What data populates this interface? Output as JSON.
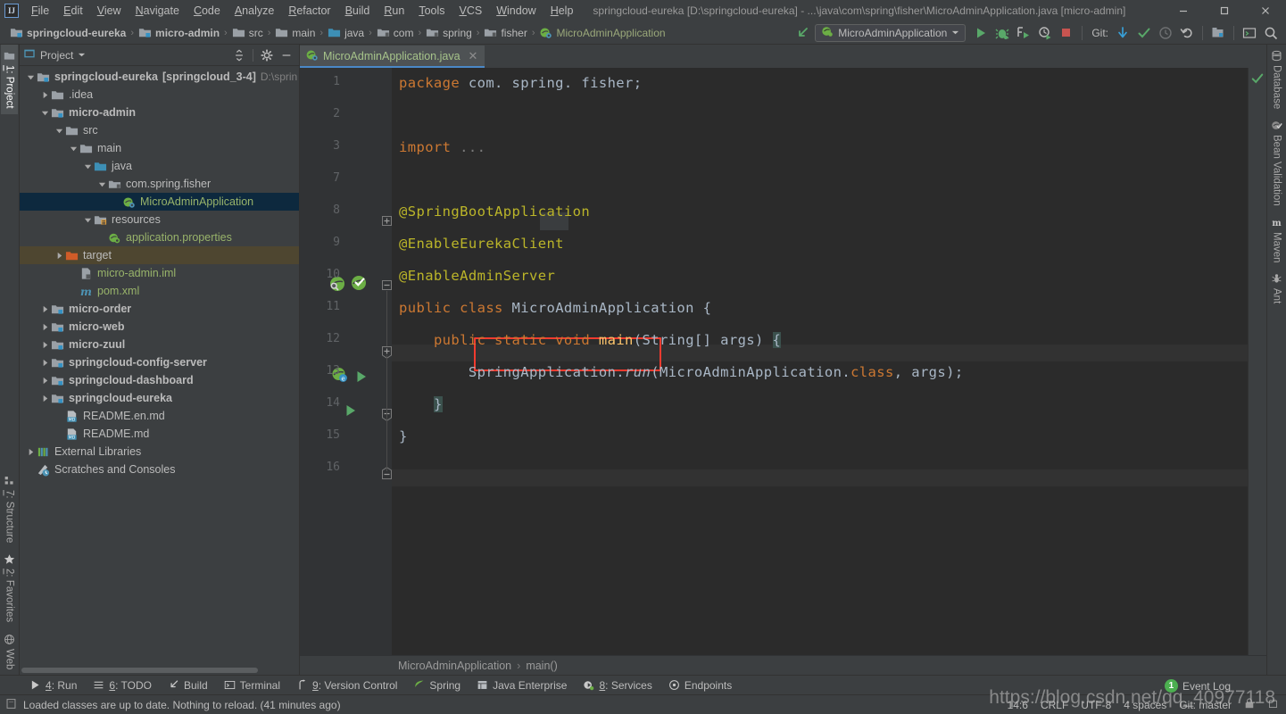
{
  "window": {
    "title": "springcloud-eureka [D:\\springcloud-eureka] - ...\\java\\com\\spring\\fisher\\MicroAdminApplication.java [micro-admin]",
    "logo": "IJ",
    "minimize": "minimize-icon",
    "maximize": "maximize-icon",
    "close": "close-icon"
  },
  "menu": [
    "File",
    "Edit",
    "View",
    "Navigate",
    "Code",
    "Analyze",
    "Refactor",
    "Build",
    "Run",
    "Tools",
    "VCS",
    "Window",
    "Help"
  ],
  "breadcrumbs": [
    {
      "label": "springcloud-eureka",
      "icon": "module-folder-icon",
      "bold": true
    },
    {
      "label": "micro-admin",
      "icon": "module-folder-icon",
      "bold": true
    },
    {
      "label": "src",
      "icon": "folder-icon",
      "bold": false
    },
    {
      "label": "main",
      "icon": "folder-icon",
      "bold": false
    },
    {
      "label": "java",
      "icon": "source-folder-icon",
      "bold": false
    },
    {
      "label": "com",
      "icon": "package-icon",
      "bold": false
    },
    {
      "label": "spring",
      "icon": "package-icon",
      "bold": false
    },
    {
      "label": "fisher",
      "icon": "package-icon",
      "bold": false
    },
    {
      "label": "MicroAdminApplication",
      "icon": "spring-class-icon",
      "bold": false,
      "green": true
    }
  ],
  "toolbar": {
    "back_arrow": "navigate-back-icon",
    "run_config": "MicroAdminApplication",
    "run_config_icon": "spring-boot-icon",
    "dropdown": "chevron-down-icon",
    "run": "run-icon",
    "debug": "debug-icon",
    "run_coverage": "run-with-coverage-icon",
    "profile": "profile-icon",
    "stop": "stop-icon",
    "git_label": "Git:",
    "git_update": "update-project-icon",
    "git_commit": "commit-icon",
    "git_history": "history-icon",
    "git_rollback": "rollback-icon",
    "project_structure": "project-structure-icon",
    "terminal": "terminal-icon",
    "search": "search-everywhere-icon"
  },
  "left_tabs": [
    {
      "label": "1: Project",
      "active": true,
      "icon": "project-icon"
    },
    {
      "label": "7: Structure",
      "active": false,
      "icon": "structure-icon"
    },
    {
      "label": "2: Favorites",
      "active": false,
      "icon": "star-icon"
    },
    {
      "label": "Web",
      "active": false,
      "icon": "web-icon"
    }
  ],
  "right_tabs": [
    {
      "label": "Database",
      "icon": "database-icon"
    },
    {
      "label": "Bean Validation",
      "icon": "bean-validation-icon"
    },
    {
      "label": "Maven",
      "icon": "maven-icon"
    },
    {
      "label": "Ant",
      "icon": "ant-icon"
    }
  ],
  "project_panel": {
    "title": "Project",
    "dropdown": "chevron-down-icon",
    "collapse_all": "collapse-all-icon",
    "settings": "gear-icon",
    "hide": "hide-icon",
    "tree": [
      {
        "label": "springcloud-eureka",
        "sub": "[springcloud_3-4]",
        "path": "D:\\sprin",
        "indent": 0,
        "arrow": "down",
        "icon": "module-folder-icon",
        "bold": true,
        "style": "root"
      },
      {
        "label": ".idea",
        "indent": 1,
        "arrow": "right",
        "icon": "folder-icon"
      },
      {
        "label": "micro-admin",
        "indent": 1,
        "arrow": "down",
        "icon": "module-folder-icon",
        "bold": true
      },
      {
        "label": "src",
        "indent": 2,
        "arrow": "down",
        "icon": "folder-icon"
      },
      {
        "label": "main",
        "indent": 3,
        "arrow": "down",
        "icon": "folder-icon"
      },
      {
        "label": "java",
        "indent": 4,
        "arrow": "down",
        "icon": "source-folder-icon"
      },
      {
        "label": "com.spring.fisher",
        "indent": 5,
        "arrow": "down",
        "icon": "package-icon"
      },
      {
        "label": "MicroAdminApplication",
        "indent": 6,
        "arrow": "none",
        "icon": "spring-class-icon",
        "selected": true,
        "color": "green"
      },
      {
        "label": "resources",
        "indent": 4,
        "arrow": "down",
        "icon": "resources-folder-icon"
      },
      {
        "label": "application.properties",
        "indent": 5,
        "arrow": "none",
        "icon": "spring-properties-icon",
        "color": "green"
      },
      {
        "label": "target",
        "indent": 2,
        "arrow": "right",
        "icon": "excluded-folder-icon",
        "target": true
      },
      {
        "label": "micro-admin.iml",
        "indent": 3,
        "arrow": "none",
        "icon": "iml-icon",
        "color": "green"
      },
      {
        "label": "pom.xml",
        "indent": 3,
        "arrow": "none",
        "icon": "maven-xml-icon",
        "color": "green"
      },
      {
        "label": "micro-order",
        "indent": 1,
        "arrow": "right",
        "icon": "module-folder-icon",
        "bold": true
      },
      {
        "label": "micro-web",
        "indent": 1,
        "arrow": "right",
        "icon": "module-folder-icon",
        "bold": true
      },
      {
        "label": "micro-zuul",
        "indent": 1,
        "arrow": "right",
        "icon": "module-folder-icon",
        "bold": true
      },
      {
        "label": "springcloud-config-server",
        "indent": 1,
        "arrow": "right",
        "icon": "module-folder-icon",
        "bold": true
      },
      {
        "label": "springcloud-dashboard",
        "indent": 1,
        "arrow": "right",
        "icon": "module-folder-icon",
        "bold": true
      },
      {
        "label": "springcloud-eureka",
        "indent": 1,
        "arrow": "right",
        "icon": "module-folder-icon",
        "bold": true
      },
      {
        "label": "README.en.md",
        "indent": 2,
        "arrow": "none",
        "icon": "markdown-icon"
      },
      {
        "label": "README.md",
        "indent": 2,
        "arrow": "none",
        "icon": "markdown-icon"
      },
      {
        "label": "External Libraries",
        "indent": 0,
        "arrow": "right",
        "icon": "libraries-icon"
      },
      {
        "label": "Scratches and Consoles",
        "indent": 0,
        "arrow": "none",
        "icon": "scratches-icon"
      }
    ]
  },
  "editor": {
    "tab": {
      "label": "MicroAdminApplication.java",
      "icon": "spring-class-icon",
      "close": "close-icon"
    },
    "inspection_status": "ok-check-icon",
    "line_numbers": [
      "1",
      "2",
      "3",
      "7",
      "8",
      "9",
      "10",
      "11",
      "12",
      "13",
      "14",
      "15",
      "16"
    ],
    "highlight_box_line": "10",
    "code_lines": [
      {
        "n": "1",
        "tokens": [
          {
            "t": "package",
            "c": "kw"
          },
          {
            "t": " com. spring. fisher;",
            "c": ""
          }
        ]
      },
      {
        "n": "2",
        "tokens": []
      },
      {
        "n": "3",
        "tokens": [
          {
            "t": "import",
            "c": "kw"
          },
          {
            "t": " ...",
            "c": "fold"
          }
        ]
      },
      {
        "n": "7",
        "tokens": []
      },
      {
        "n": "8",
        "tokens": [
          {
            "t": "@SpringBootApplication",
            "c": "ann"
          }
        ]
      },
      {
        "n": "9",
        "tokens": [
          {
            "t": "@EnableEurekaClient",
            "c": "ann"
          }
        ]
      },
      {
        "n": "10",
        "tokens": [
          {
            "t": "@EnableAdminServer",
            "c": "ann"
          }
        ]
      },
      {
        "n": "11",
        "tokens": [
          {
            "t": "public class",
            "c": "kw"
          },
          {
            "t": " MicroAdminApplication {",
            "c": ""
          }
        ]
      },
      {
        "n": "12",
        "tokens": [
          {
            "t": "    ",
            "c": ""
          },
          {
            "t": "public static void",
            "c": "kw"
          },
          {
            "t": " ",
            "c": ""
          },
          {
            "t": "main",
            "c": "mname"
          },
          {
            "t": "(String[] args) ",
            "c": ""
          },
          {
            "t": "{",
            "c": "brace"
          }
        ]
      },
      {
        "n": "13",
        "tokens": [
          {
            "t": "        SpringApplication.",
            "c": ""
          },
          {
            "t": "run",
            "c": "ital"
          },
          {
            "t": "(MicroAdminApplication.",
            "c": ""
          },
          {
            "t": "class",
            "c": "kw"
          },
          {
            "t": ", args);",
            "c": ""
          }
        ]
      },
      {
        "n": "14",
        "tokens": [
          {
            "t": "    ",
            "c": ""
          },
          {
            "t": "}",
            "c": "brace"
          }
        ]
      },
      {
        "n": "15",
        "tokens": [
          {
            "t": "}",
            "c": ""
          }
        ]
      },
      {
        "n": "16",
        "tokens": []
      }
    ],
    "gutter_icons": [
      {
        "line": "8",
        "icon": "spring-bean-search-icon"
      },
      {
        "line": "8",
        "icon": "spring-config-check-icon"
      },
      {
        "line": "11",
        "icon": "spring-boot-class-icon"
      },
      {
        "line": "11",
        "icon": "run-gutter-icon"
      },
      {
        "line": "12",
        "icon": "run-gutter-icon"
      }
    ],
    "breadcrumb": [
      "MicroAdminApplication",
      "main()"
    ]
  },
  "bottom_tool_windows": [
    {
      "label": "4: Run",
      "icon": "run-icon"
    },
    {
      "label": "6: TODO",
      "icon": "todo-icon"
    },
    {
      "label": "Build",
      "icon": "build-icon"
    },
    {
      "label": "Terminal",
      "icon": "terminal-icon"
    },
    {
      "label": "9: Version Control",
      "icon": "vcs-icon"
    },
    {
      "label": "Spring",
      "icon": "spring-leaf-icon"
    },
    {
      "label": "Java Enterprise",
      "icon": "java-enterprise-icon"
    },
    {
      "label": "8: Services",
      "icon": "services-icon"
    },
    {
      "label": "Endpoints",
      "icon": "endpoints-icon"
    }
  ],
  "status_bar": {
    "icon": "message-icon",
    "message": "Loaded classes are up to date. Nothing to reload. (41 minutes ago)",
    "caret": "14:6",
    "line_separator": "CRLF",
    "encoding": "UTF-8",
    "indent": "4 spaces",
    "branch": "Git: master",
    "read_only": "lock-icon",
    "memory": "memory-icon"
  },
  "event_log": {
    "count": "1",
    "label": "Event Log"
  },
  "watermark": "https://blog.csdn.net/qq_40977118",
  "colors": {
    "chrome": "#3c3f41",
    "editor_bg": "#2b2b2b",
    "gutter_bg": "#313335",
    "selection": "#0d293e",
    "target_row": "#4e4630",
    "accent_blue": "#4a88c7",
    "annotation": "#bbb529",
    "keyword": "#cc7832",
    "string_green": "#6a8759",
    "method": "#ffc66d",
    "highlight_red": "#f23b2f",
    "badge_green": "#4caf50"
  }
}
